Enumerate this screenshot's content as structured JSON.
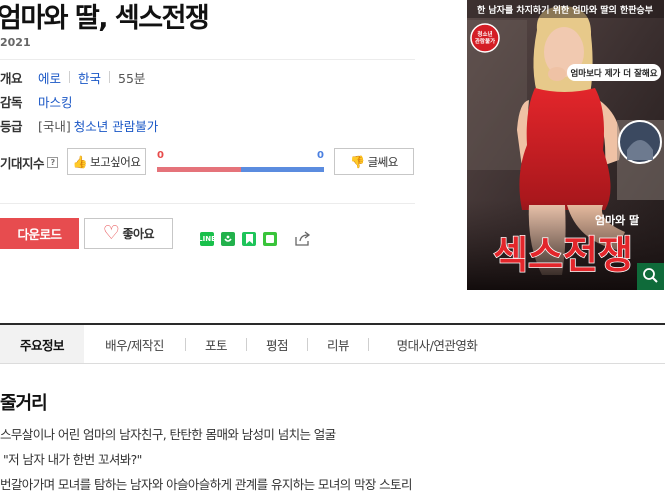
{
  "movie": {
    "title": "엄마와 딸, 섹스전쟁",
    "year": "2021"
  },
  "info": {
    "overview_label": "개요",
    "genre": "에로",
    "country": "한국",
    "runtime": "55분",
    "director_label": "감독",
    "director": "마스킹",
    "rating_label": "등급",
    "rating_prefix": "[국내]",
    "rating": "청소년 관람불가"
  },
  "expectation": {
    "label": "기대지수",
    "help": "?",
    "want_label": "보고싶어요",
    "nah_label": "글쎄요",
    "want_count": "0",
    "nah_count": "0",
    "want_ratio": 0.5,
    "want_color": "#e5737a",
    "nah_color": "#5b8cdf"
  },
  "actions": {
    "download_label": "다운로드",
    "like_label": "좋아요"
  },
  "share": {
    "line_label": "LINE",
    "icons": [
      "line-icon",
      "band-icon",
      "bookmark-icon",
      "cafe-icon",
      "share-out-icon"
    ]
  },
  "poster": {
    "top_caption": "한 남자를 차지하기 위한 엄마와 딸의 한판승부",
    "age_badge": "청소년 관람불가",
    "speech": "엄마보다 제가 더 잘해요",
    "subtitle": "엄마와 딸",
    "big_title": "섹스전쟁"
  },
  "tabs": [
    {
      "label": "주요정보",
      "active": true
    },
    {
      "label": "배우/제작진",
      "active": false
    },
    {
      "label": "포토",
      "active": false
    },
    {
      "label": "평점",
      "active": false
    },
    {
      "label": "리뷰",
      "active": false
    },
    {
      "label": "명대사/연관영화",
      "active": false
    }
  ],
  "synopsis": {
    "heading": "줄거리",
    "lines": [
      "스무살이나 어린 엄마의 남자친구, 탄탄한 몸매와 남성미 넘치는 얼굴",
      "\"저 남자 내가 한번 꼬셔봐?\"",
      "번갈아가며 모녀를 탐하는 남자와 아슬아슬하게 관계를 유지하는 모녀의 막장 스토리"
    ]
  },
  "colors": {
    "accent_red": "#e74c4f",
    "link_blue": "#1a57c6"
  }
}
